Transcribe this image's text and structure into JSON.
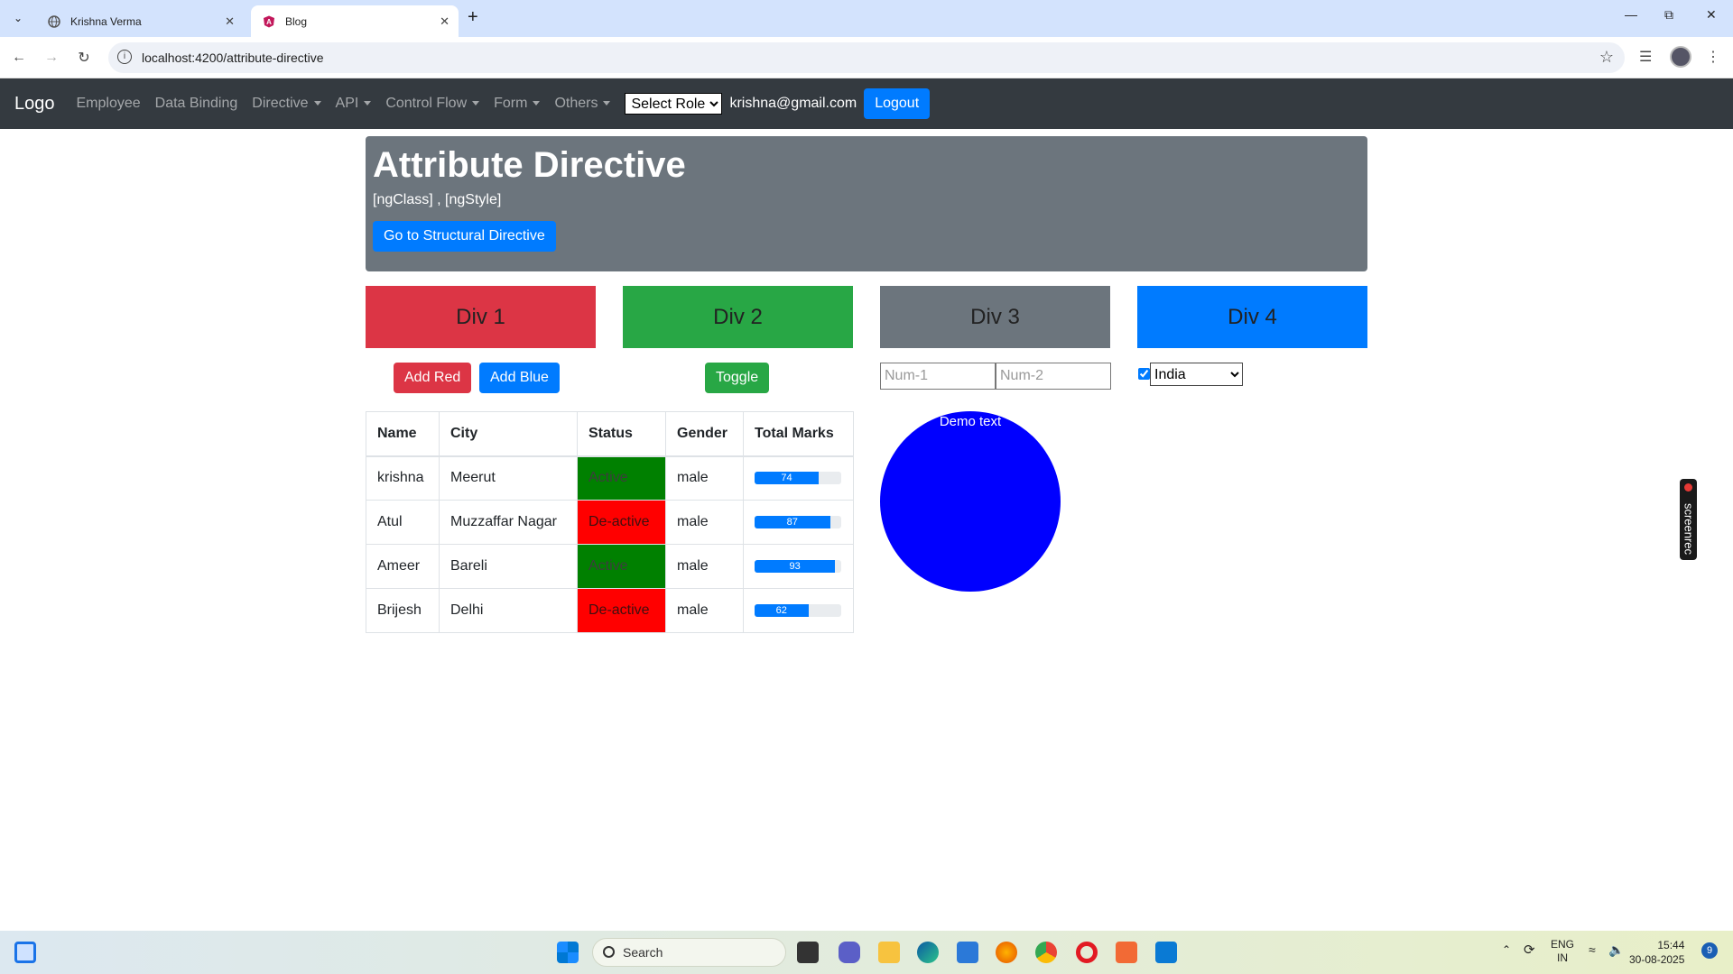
{
  "browser": {
    "tabs": [
      {
        "title": "Krishna Verma",
        "icon": "globe-icon"
      },
      {
        "title": "Blog",
        "icon": "angular-icon"
      }
    ],
    "url": "localhost:4200/attribute-directive"
  },
  "navbar": {
    "brand": "Logo",
    "links": [
      "Employee",
      "Data Binding",
      "Directive",
      "API",
      "Control Flow",
      "Form",
      "Others"
    ],
    "role_select": "Select Role",
    "email": "krishna@gmail.com",
    "logout": "Logout"
  },
  "jumbotron": {
    "title": "Attribute Directive",
    "subtitle": "[ngClass] , [ngStyle]",
    "button": "Go to Structural Directive"
  },
  "divs": [
    {
      "label": "Div 1",
      "color": "#dc3545"
    },
    {
      "label": "Div 2",
      "color": "#28a745"
    },
    {
      "label": "Div 3",
      "color": "#6c757d"
    },
    {
      "label": "Div 4",
      "color": "#007bff"
    }
  ],
  "controls": {
    "add_red": "Add Red",
    "add_blue": "Add Blue",
    "toggle": "Toggle",
    "num1_placeholder": "Num-1",
    "num2_placeholder": "Num-2",
    "checkbox_checked": true,
    "country": "India"
  },
  "table": {
    "headers": [
      "Name",
      "City",
      "Status",
      "Gender",
      "Total Marks"
    ],
    "rows": [
      {
        "name": "krishna",
        "city": "Meerut",
        "status": "Active",
        "gender": "male",
        "marks": "74"
      },
      {
        "name": "Atul",
        "city": "Muzzaffar Nagar",
        "status": "De-active",
        "gender": "male",
        "marks": "87"
      },
      {
        "name": "Ameer",
        "city": "Bareli",
        "status": "Active",
        "gender": "male",
        "marks": "93"
      },
      {
        "name": "Brijesh",
        "city": "Delhi",
        "status": "De-active",
        "gender": "male",
        "marks": "62"
      }
    ]
  },
  "circle": {
    "text": "Demo text",
    "color": "#0000ff"
  },
  "screenrec": "screenrec",
  "taskbar": {
    "search": "Search",
    "lang": "ENG",
    "region": "IN",
    "time": "15:44",
    "date": "30-08-2025",
    "notifications": "9"
  }
}
